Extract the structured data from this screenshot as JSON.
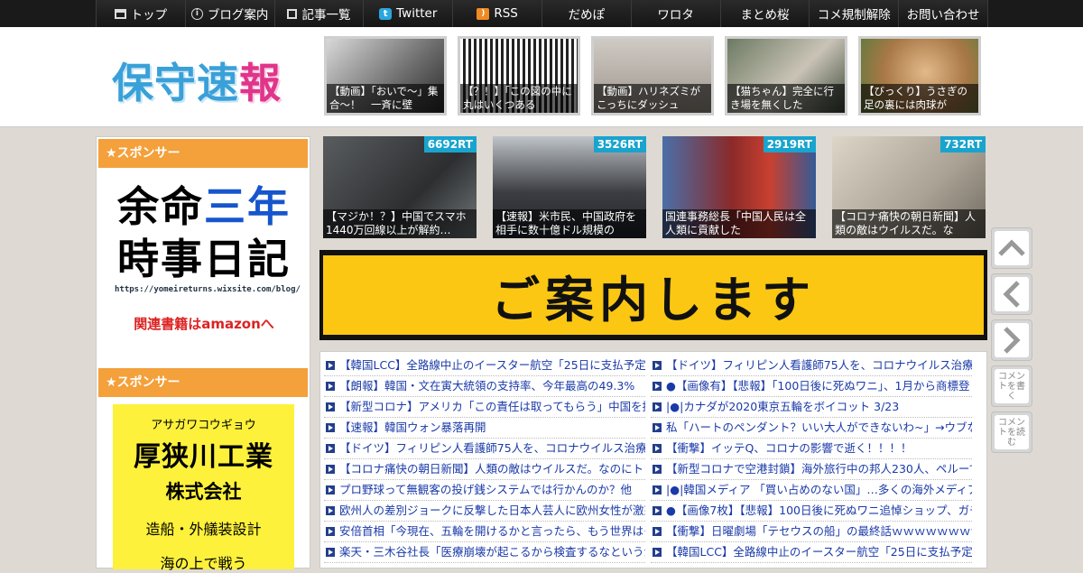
{
  "nav": {
    "items": [
      {
        "label": "トップ",
        "icon": "home-icon"
      },
      {
        "label": "ブログ案内",
        "icon": "info-icon"
      },
      {
        "label": "記事一覧",
        "icon": "list-icon"
      },
      {
        "label": "Twitter",
        "icon": "twitter-icon"
      },
      {
        "label": "RSS",
        "icon": "rss-icon"
      },
      {
        "label": "だめぽ",
        "icon": ""
      },
      {
        "label": "ワロタ",
        "icon": ""
      },
      {
        "label": "まとめ桜",
        "icon": ""
      },
      {
        "label": "コメ規制解除",
        "icon": ""
      },
      {
        "label": "お問い合わせ",
        "icon": ""
      }
    ]
  },
  "header": {
    "logo": [
      "保",
      "守",
      "速",
      "報"
    ],
    "logo_colors": [
      "#3aa0d8",
      "#3aa0d8",
      "#3aa0d8",
      "#e0358a"
    ],
    "thumbs": [
      "【動画】「おいで～」集合～！　一斉に壁",
      "【？！】「この図の中に丸はいくつある",
      "【動画】ハリネズミがこっちにダッシュ",
      "【猫ちゃん】完全に行き場を無くした",
      "【びっくり】うさぎの足の裏には肉球が"
    ]
  },
  "sidebar": {
    "sponsor_label": "★スポンサー",
    "ad1": {
      "line1a": "余命",
      "line1b": "三年",
      "line2": "時事日記",
      "url": "https://yomeireturns.wixsite.com/blog/",
      "link": "関連書籍はamazonへ"
    },
    "ad2": {
      "kana": "アサガワコウギョウ",
      "name1": "厚狭川工業",
      "name2": "株式会社",
      "desc": "造船・外艤装設計",
      "tail": "海の上で戦う"
    }
  },
  "main": {
    "thumbs": [
      {
        "rt": "6692RT",
        "caption": "【マジか！？】中国でスマホ1440万回線以上が解約…"
      },
      {
        "rt": "3526RT",
        "caption": "【速報】米市民、中国政府を相手に数十億ドル規模の"
      },
      {
        "rt": "2919RT",
        "caption": "国連事務総長「中国人民は全人類に貢献した"
      },
      {
        "rt": "732RT",
        "caption": "【コロナ痛快の朝日新聞】人類の敵はウイルスだ。な"
      }
    ],
    "banner": "ご案内します",
    "left_list": [
      "【韓国LCC】全路線中止のイースター航空「25日に支払予定い",
      "【朗報】韓国・文在寅大統領の支持率、今年最高の49.3%",
      "【新型コロナ】アメリカ「この責任は取ってもらう」中国を提",
      "【速報】韓国ウォン暴落再開",
      "【ドイツ】フィリピン人看護師75人を、コロナウイルス治療の",
      "【コロナ痛快の朝日新聞】人類の敵はウイルスだ。なのにトラ",
      "プロ野球って無観客の投げ銭システムでは行かんのか？他",
      "欧州人の差別ジョークに反撃した日本人芸人に欧州女性が激怒",
      "安倍首相「今現在、五輪を開けるかと言ったら、もう世界はそ",
      "楽天・三木谷社長「医療崩壊が起こるから検査するなというが"
    ],
    "right_list": [
      "【ドイツ】フィリピン人看護師75人を、コロナウイルス治療の",
      "●【画像有】【悲報】「100日後に死ぬワニ」、1月から商標登",
      "|●|カナダが2020東京五輪をボイコット 3/23",
      "私「ハートのペンダント？いい大人ができないわ~」→ウブな",
      "【衝撃】イッテQ、コロナの影響で逝く！！！！",
      "【新型コロナで空港封鎖】海外旅行中の邦人230人、ペルーで足",
      "|●|韓国メディア 「買い占めのない国」…多くの海外メディアは",
      "●【画像7枚】【悲報】100日後に死ぬワニ追悼ショップ、ガチで",
      "【衝撃】日曜劇場「テセウスの船」の最終話ｗｗｗｗｗｗｗｗ",
      "【韓国LCC】全路線中止のイースター航空「25日に支払予定い"
    ]
  },
  "side_buttons": {
    "up": "up-arrow-icon",
    "prev": "left-arrow-icon",
    "next": "right-arrow-icon",
    "write": "コメントを書く",
    "read": "コメントを読む"
  }
}
